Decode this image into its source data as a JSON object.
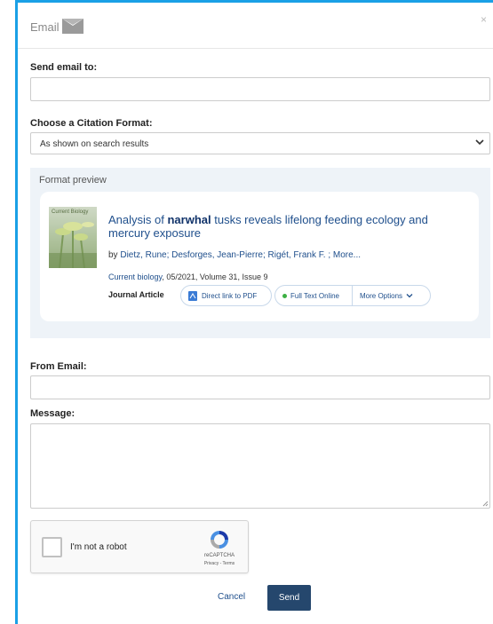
{
  "header": {
    "title": "Email",
    "close_glyph": "×",
    "icon": "envelope-icon"
  },
  "send_to": {
    "label": "Send email to:",
    "value": "",
    "placeholder": ""
  },
  "citation": {
    "label": "Choose a Citation Format:",
    "selected": "As shown on search results"
  },
  "preview": {
    "title": "Format preview",
    "thumbnail_text": "Current Biology",
    "record": {
      "title_highlight": "narwhal",
      "title_before": "Analysis of ",
      "title_after": " tusks reveals lifelong feeding ecology and mercury exposure",
      "authors_prefix": "by ",
      "authors": "Dietz, Rune; Desforges, Jean-Pierre; Rigét, Frank F. ; More...",
      "journal": "Current biology",
      "issue_info": ", 05/2021, Volume 31, Issue 9",
      "type": "Journal Article",
      "pdf_link": "Direct link to PDF",
      "fulltext_link": "Full Text Online",
      "more_options": "More Options"
    }
  },
  "from_email": {
    "label": "From Email:",
    "value": ""
  },
  "message": {
    "label": "Message:",
    "value": ""
  },
  "recaptcha": {
    "label": "I'm not a robot",
    "brand": "reCAPTCHA",
    "links": "Privacy - Terms"
  },
  "actions": {
    "cancel": "Cancel",
    "send": "Send"
  },
  "colors": {
    "accent_border": "#1aa0e6",
    "send_button": "#25476d",
    "link": "#1f4f8c",
    "preview_bg": "#eef3f8",
    "available_dot": "#3cb043"
  }
}
